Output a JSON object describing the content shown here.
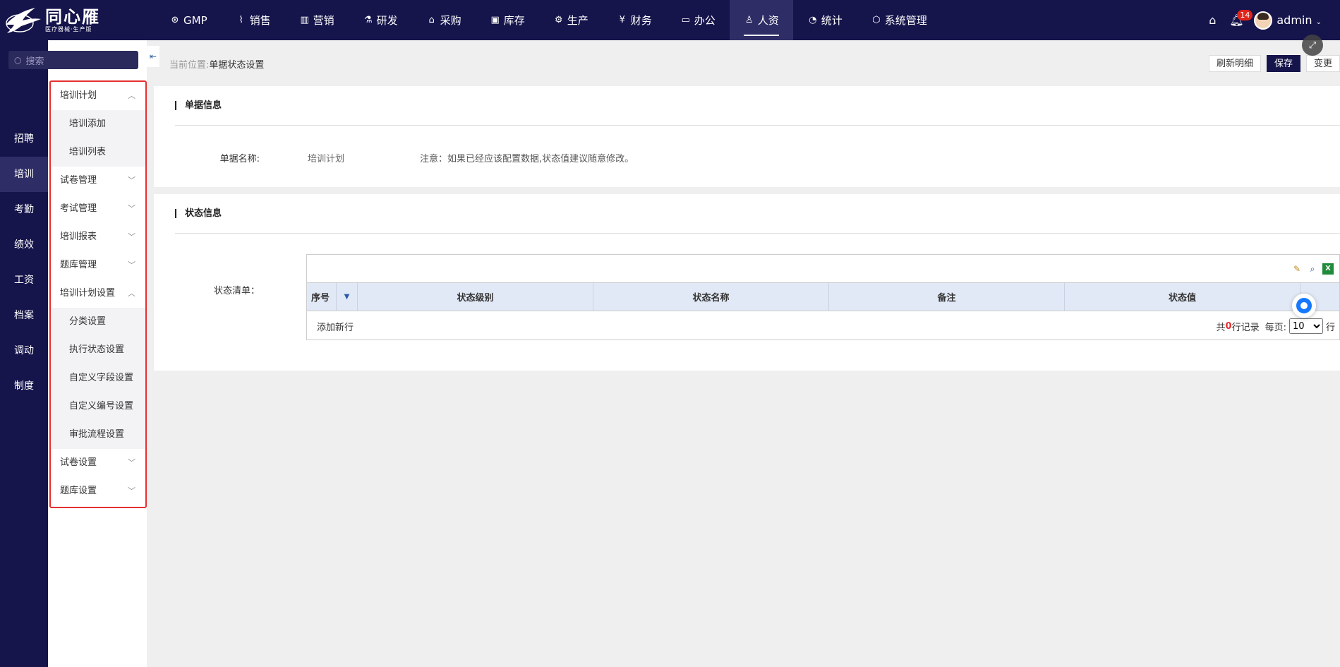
{
  "brand": {
    "name": "同心雁",
    "tagline": "医疗器械·生产版"
  },
  "nav": [
    {
      "label": "GMP",
      "icon": "gmp-icon",
      "glyph": "⊛"
    },
    {
      "label": "销售",
      "icon": "sales-chart-icon",
      "glyph": "⌇"
    },
    {
      "label": "营销",
      "icon": "bar-chart-icon",
      "glyph": "▥"
    },
    {
      "label": "研发",
      "icon": "flask-icon",
      "glyph": "⚗"
    },
    {
      "label": "采购",
      "icon": "basket-icon",
      "glyph": "⌂"
    },
    {
      "label": "库存",
      "icon": "inventory-icon",
      "glyph": "▣"
    },
    {
      "label": "生产",
      "icon": "production-icon",
      "glyph": "⚙"
    },
    {
      "label": "财务",
      "icon": "yen-icon",
      "glyph": "¥"
    },
    {
      "label": "办公",
      "icon": "briefcase-icon",
      "glyph": "▭"
    },
    {
      "label": "人资",
      "icon": "user-icon",
      "glyph": "♙",
      "active": true
    },
    {
      "label": "统计",
      "icon": "pie-chart-icon",
      "glyph": "◔"
    },
    {
      "label": "系统管理",
      "icon": "settings-icon",
      "glyph": "⬡"
    }
  ],
  "top_right": {
    "notifications": "14",
    "user": "admin"
  },
  "search": {
    "placeholder": "搜索"
  },
  "left_menu": [
    {
      "label": "招聘"
    },
    {
      "label": "培训",
      "active": true
    },
    {
      "label": "考勤"
    },
    {
      "label": "绩效"
    },
    {
      "label": "工资"
    },
    {
      "label": "档案"
    },
    {
      "label": "调动"
    },
    {
      "label": "制度"
    }
  ],
  "submenu": [
    {
      "type": "group",
      "label": "培训计划",
      "open": true
    },
    {
      "type": "item",
      "label": "培训添加"
    },
    {
      "type": "item",
      "label": "培训列表"
    },
    {
      "type": "group",
      "label": "试卷管理",
      "open": false
    },
    {
      "type": "group",
      "label": "考试管理",
      "open": false
    },
    {
      "type": "group",
      "label": "培训报表",
      "open": false
    },
    {
      "type": "group",
      "label": "题库管理",
      "open": false
    },
    {
      "type": "group",
      "label": "培训计划设置",
      "open": true
    },
    {
      "type": "item",
      "label": "分类设置"
    },
    {
      "type": "item",
      "label": "执行状态设置"
    },
    {
      "type": "item",
      "label": "自定义字段设置"
    },
    {
      "type": "item",
      "label": "自定义编号设置"
    },
    {
      "type": "item",
      "label": "审批流程设置"
    },
    {
      "type": "group",
      "label": "试卷设置",
      "open": false
    },
    {
      "type": "group",
      "label": "题库设置",
      "open": false
    }
  ],
  "breadcrumb": {
    "label": "当前位置:",
    "value": "单据状态设置"
  },
  "toolbar": {
    "refresh": "刷新明细",
    "save": "保存",
    "change": "变更"
  },
  "doc_info": {
    "title": "单据信息",
    "name_label": "单据名称:",
    "name_value": "培训计划",
    "note": "注意：如果已经应该配置数据,状态值建议随意修改。"
  },
  "status_info": {
    "title": "状态信息",
    "list_label": "状态清单：",
    "columns": [
      "序号",
      "状态级别",
      "状态名称",
      "备注",
      "状态值"
    ],
    "add_row": "添加新行",
    "total_prefix": "共",
    "total_count": "0",
    "total_suffix": "行记录",
    "per_page_label": "每页:",
    "per_page_value": "10",
    "per_page_unit": "行"
  }
}
